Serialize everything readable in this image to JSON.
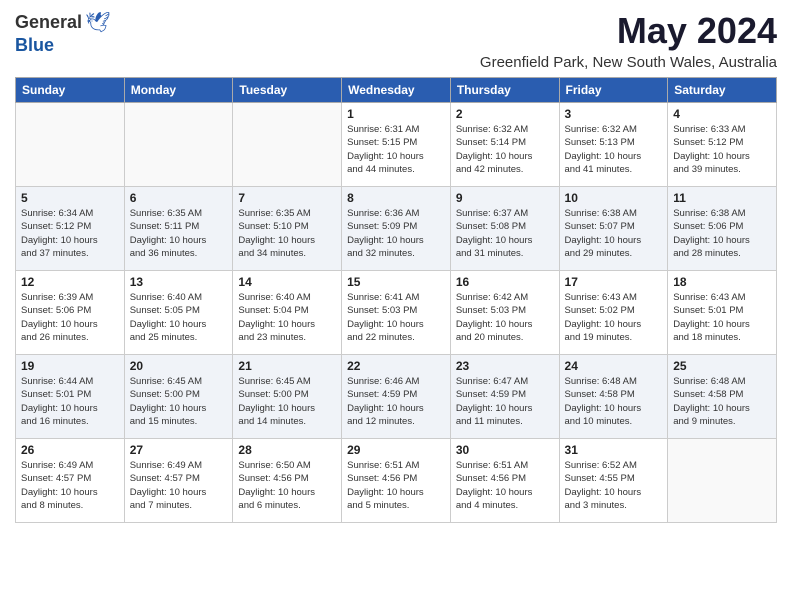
{
  "logo": {
    "general": "General",
    "blue": "Blue"
  },
  "title": "May 2024",
  "location": "Greenfield Park, New South Wales, Australia",
  "days_of_week": [
    "Sunday",
    "Monday",
    "Tuesday",
    "Wednesday",
    "Thursday",
    "Friday",
    "Saturday"
  ],
  "weeks": [
    [
      {
        "day": "",
        "info": ""
      },
      {
        "day": "",
        "info": ""
      },
      {
        "day": "",
        "info": ""
      },
      {
        "day": "1",
        "info": "Sunrise: 6:31 AM\nSunset: 5:15 PM\nDaylight: 10 hours\nand 44 minutes."
      },
      {
        "day": "2",
        "info": "Sunrise: 6:32 AM\nSunset: 5:14 PM\nDaylight: 10 hours\nand 42 minutes."
      },
      {
        "day": "3",
        "info": "Sunrise: 6:32 AM\nSunset: 5:13 PM\nDaylight: 10 hours\nand 41 minutes."
      },
      {
        "day": "4",
        "info": "Sunrise: 6:33 AM\nSunset: 5:12 PM\nDaylight: 10 hours\nand 39 minutes."
      }
    ],
    [
      {
        "day": "5",
        "info": "Sunrise: 6:34 AM\nSunset: 5:12 PM\nDaylight: 10 hours\nand 37 minutes."
      },
      {
        "day": "6",
        "info": "Sunrise: 6:35 AM\nSunset: 5:11 PM\nDaylight: 10 hours\nand 36 minutes."
      },
      {
        "day": "7",
        "info": "Sunrise: 6:35 AM\nSunset: 5:10 PM\nDaylight: 10 hours\nand 34 minutes."
      },
      {
        "day": "8",
        "info": "Sunrise: 6:36 AM\nSunset: 5:09 PM\nDaylight: 10 hours\nand 32 minutes."
      },
      {
        "day": "9",
        "info": "Sunrise: 6:37 AM\nSunset: 5:08 PM\nDaylight: 10 hours\nand 31 minutes."
      },
      {
        "day": "10",
        "info": "Sunrise: 6:38 AM\nSunset: 5:07 PM\nDaylight: 10 hours\nand 29 minutes."
      },
      {
        "day": "11",
        "info": "Sunrise: 6:38 AM\nSunset: 5:06 PM\nDaylight: 10 hours\nand 28 minutes."
      }
    ],
    [
      {
        "day": "12",
        "info": "Sunrise: 6:39 AM\nSunset: 5:06 PM\nDaylight: 10 hours\nand 26 minutes."
      },
      {
        "day": "13",
        "info": "Sunrise: 6:40 AM\nSunset: 5:05 PM\nDaylight: 10 hours\nand 25 minutes."
      },
      {
        "day": "14",
        "info": "Sunrise: 6:40 AM\nSunset: 5:04 PM\nDaylight: 10 hours\nand 23 minutes."
      },
      {
        "day": "15",
        "info": "Sunrise: 6:41 AM\nSunset: 5:03 PM\nDaylight: 10 hours\nand 22 minutes."
      },
      {
        "day": "16",
        "info": "Sunrise: 6:42 AM\nSunset: 5:03 PM\nDaylight: 10 hours\nand 20 minutes."
      },
      {
        "day": "17",
        "info": "Sunrise: 6:43 AM\nSunset: 5:02 PM\nDaylight: 10 hours\nand 19 minutes."
      },
      {
        "day": "18",
        "info": "Sunrise: 6:43 AM\nSunset: 5:01 PM\nDaylight: 10 hours\nand 18 minutes."
      }
    ],
    [
      {
        "day": "19",
        "info": "Sunrise: 6:44 AM\nSunset: 5:01 PM\nDaylight: 10 hours\nand 16 minutes."
      },
      {
        "day": "20",
        "info": "Sunrise: 6:45 AM\nSunset: 5:00 PM\nDaylight: 10 hours\nand 15 minutes."
      },
      {
        "day": "21",
        "info": "Sunrise: 6:45 AM\nSunset: 5:00 PM\nDaylight: 10 hours\nand 14 minutes."
      },
      {
        "day": "22",
        "info": "Sunrise: 6:46 AM\nSunset: 4:59 PM\nDaylight: 10 hours\nand 12 minutes."
      },
      {
        "day": "23",
        "info": "Sunrise: 6:47 AM\nSunset: 4:59 PM\nDaylight: 10 hours\nand 11 minutes."
      },
      {
        "day": "24",
        "info": "Sunrise: 6:48 AM\nSunset: 4:58 PM\nDaylight: 10 hours\nand 10 minutes."
      },
      {
        "day": "25",
        "info": "Sunrise: 6:48 AM\nSunset: 4:58 PM\nDaylight: 10 hours\nand 9 minutes."
      }
    ],
    [
      {
        "day": "26",
        "info": "Sunrise: 6:49 AM\nSunset: 4:57 PM\nDaylight: 10 hours\nand 8 minutes."
      },
      {
        "day": "27",
        "info": "Sunrise: 6:49 AM\nSunset: 4:57 PM\nDaylight: 10 hours\nand 7 minutes."
      },
      {
        "day": "28",
        "info": "Sunrise: 6:50 AM\nSunset: 4:56 PM\nDaylight: 10 hours\nand 6 minutes."
      },
      {
        "day": "29",
        "info": "Sunrise: 6:51 AM\nSunset: 4:56 PM\nDaylight: 10 hours\nand 5 minutes."
      },
      {
        "day": "30",
        "info": "Sunrise: 6:51 AM\nSunset: 4:56 PM\nDaylight: 10 hours\nand 4 minutes."
      },
      {
        "day": "31",
        "info": "Sunrise: 6:52 AM\nSunset: 4:55 PM\nDaylight: 10 hours\nand 3 minutes."
      },
      {
        "day": "",
        "info": ""
      }
    ]
  ]
}
